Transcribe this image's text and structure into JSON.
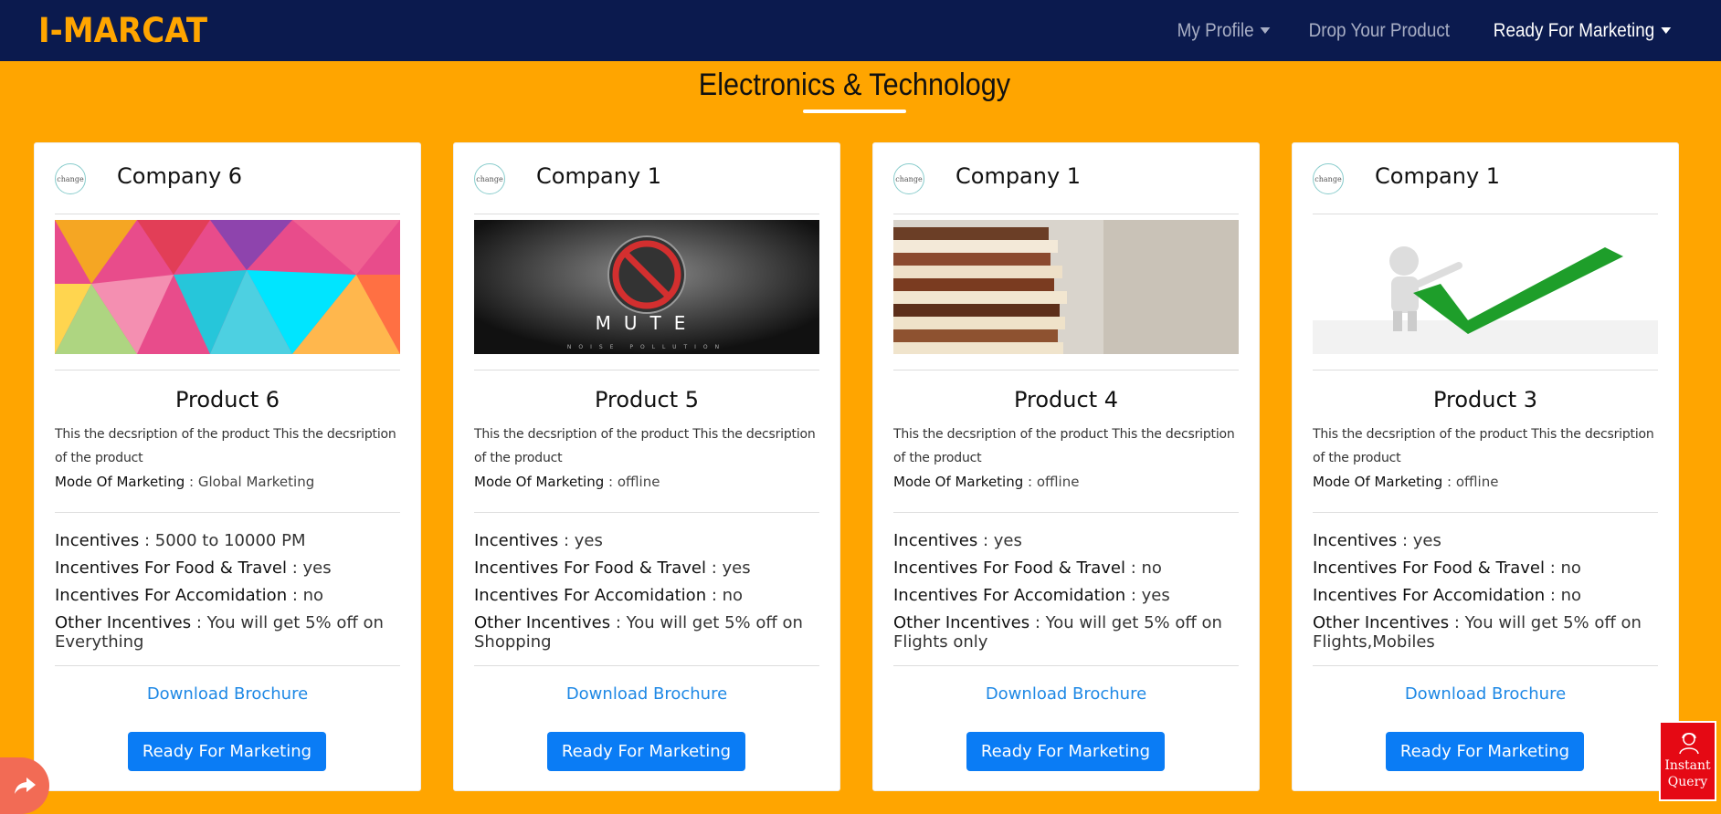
{
  "navbar": {
    "brand": "I-MARCAT",
    "items": [
      {
        "label": "My Profile",
        "has_caret": true
      },
      {
        "label": "Drop Your Product",
        "has_caret": false
      },
      {
        "label": "Ready For Marketing",
        "has_caret": true
      }
    ]
  },
  "section": {
    "title": "Electronics & Technology"
  },
  "cards": [
    {
      "company": "Company 6",
      "image": "colorful-polygon-image",
      "product": "Product 6",
      "description": "This the decsription of the product This the decsription of the product",
      "mode_label": "Mode Of Marketing",
      "mode_value": "Global Marketing",
      "incentives": [
        {
          "label": "Incentives",
          "value": "5000 to 10000 PM"
        },
        {
          "label": "Incentives For Food & Travel",
          "value": "yes"
        },
        {
          "label": "Incentives For Accomidation",
          "value": "no"
        },
        {
          "label": "Other Incentives",
          "value": "You will get 5% off on Everything"
        }
      ],
      "download": "Download Brochure",
      "button": "Ready For Marketing"
    },
    {
      "company": "Company 1",
      "image": "mute-noise-pollution-image",
      "product": "Product 5",
      "description": "This the decsription of the product This the decsription of the product",
      "mode_label": "Mode Of Marketing",
      "mode_value": "offline",
      "incentives": [
        {
          "label": "Incentives",
          "value": "yes"
        },
        {
          "label": "Incentives For Food & Travel",
          "value": "yes"
        },
        {
          "label": "Incentives For Accomidation",
          "value": "no"
        },
        {
          "label": "Other Incentives",
          "value": "You will get 5% off on Shopping"
        }
      ],
      "download": "Download Brochure",
      "button": "Ready For Marketing"
    },
    {
      "company": "Company 1",
      "image": "stack-of-books-image",
      "product": "Product 4",
      "description": "This the decsription of the product This the decsription of the product",
      "mode_label": "Mode Of Marketing",
      "mode_value": "offline",
      "incentives": [
        {
          "label": "Incentives",
          "value": "yes"
        },
        {
          "label": "Incentives For Food & Travel",
          "value": "no"
        },
        {
          "label": "Incentives For Accomidation",
          "value": "yes"
        },
        {
          "label": "Other Incentives",
          "value": "You will get 5% off on Flights only"
        }
      ],
      "download": "Download Brochure",
      "button": "Ready For Marketing"
    },
    {
      "company": "Company 1",
      "image": "person-with-checkmark-image",
      "product": "Product 3",
      "description": "This the decsription of the product This the decsription of the product",
      "mode_label": "Mode Of Marketing",
      "mode_value": "offline",
      "incentives": [
        {
          "label": "Incentives",
          "value": "yes"
        },
        {
          "label": "Incentives For Food & Travel",
          "value": "no"
        },
        {
          "label": "Incentives For Accomidation",
          "value": "no"
        },
        {
          "label": "Other Incentives",
          "value": "You will get 5% off on Flights,Mobiles"
        }
      ],
      "download": "Download Brochure",
      "button": "Ready For Marketing"
    }
  ],
  "logo_text": "change",
  "floating": {
    "share_icon": "share-arrow-icon",
    "instant_label_1": "Instant",
    "instant_label_2": "Query"
  },
  "colors": {
    "navbar_bg": "#0B1A4E",
    "brand": "#FFA500",
    "page_bg": "#FFA500",
    "button": "#0A7CF5",
    "link": "#1E88E5",
    "instant_query": "#E50914",
    "share": "#F26B55"
  }
}
